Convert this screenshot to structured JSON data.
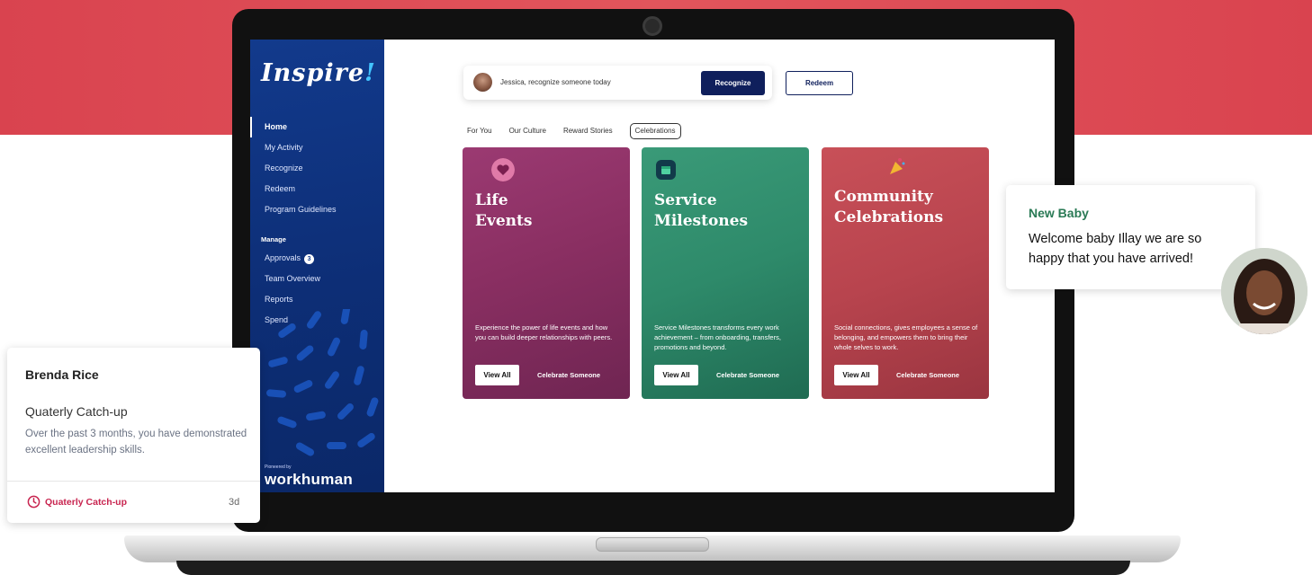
{
  "app": {
    "logo": "Inspire",
    "logo_bang": "!"
  },
  "sidebar": {
    "items": [
      {
        "label": "Home",
        "active": true
      },
      {
        "label": "My Activity"
      },
      {
        "label": "Recognize"
      },
      {
        "label": "Redeem"
      },
      {
        "label": "Program Guidelines"
      }
    ],
    "manage_heading": "Manage",
    "manage_items": [
      {
        "label": "Approvals",
        "badge": "3"
      },
      {
        "label": "Team Overview"
      },
      {
        "label": "Reports"
      },
      {
        "label": "Spend"
      }
    ],
    "footer_small": "Pioneered by",
    "footer_brand": "workhuman"
  },
  "header": {
    "placeholder": "Jessica, recognize someone today",
    "recognize_label": "Recognize",
    "redeem_label": "Redeem"
  },
  "tabs": [
    {
      "label": "For You"
    },
    {
      "label": "Our Culture"
    },
    {
      "label": "Reward Stories"
    },
    {
      "label": "Celebrations",
      "active": true
    }
  ],
  "cards": [
    {
      "title_line1": "Life",
      "title_line2": "Events",
      "description": "Experience the power of life events and how you can build deeper relationships with peers.",
      "view_label": "View All",
      "celebrate_label": "Celebrate Someone",
      "color": "#8a2f62"
    },
    {
      "title_line1": "Service",
      "title_line2": "Milestones",
      "description": "Service Milestones transforms every work achievement – from onboarding, transfers, promotions and beyond.",
      "view_label": "View All",
      "celebrate_label": "Celebrate Someone",
      "color": "#2e8a6a"
    },
    {
      "title_line1": "Community",
      "title_line2": "Celebrations",
      "description": "Social connections, gives employees a sense of belonging, and empowers them to bring their whole selves to work.",
      "view_label": "View All",
      "celebrate_label": "Celebrate Someone",
      "color": "#b8444e"
    }
  ],
  "notification_left": {
    "name": "Brenda Rice",
    "subject": "Quaterly Catch-up",
    "body": "Over the past 3 months, you have demonstrated excellent leadership skills.",
    "footer_label": "Quaterly Catch-up",
    "age": "3d",
    "accent": "#c8244f"
  },
  "notification_right": {
    "heading": "New Baby",
    "text": "Welcome baby Illay we are so happy that you have arrived!",
    "accent": "#2a7a55"
  }
}
